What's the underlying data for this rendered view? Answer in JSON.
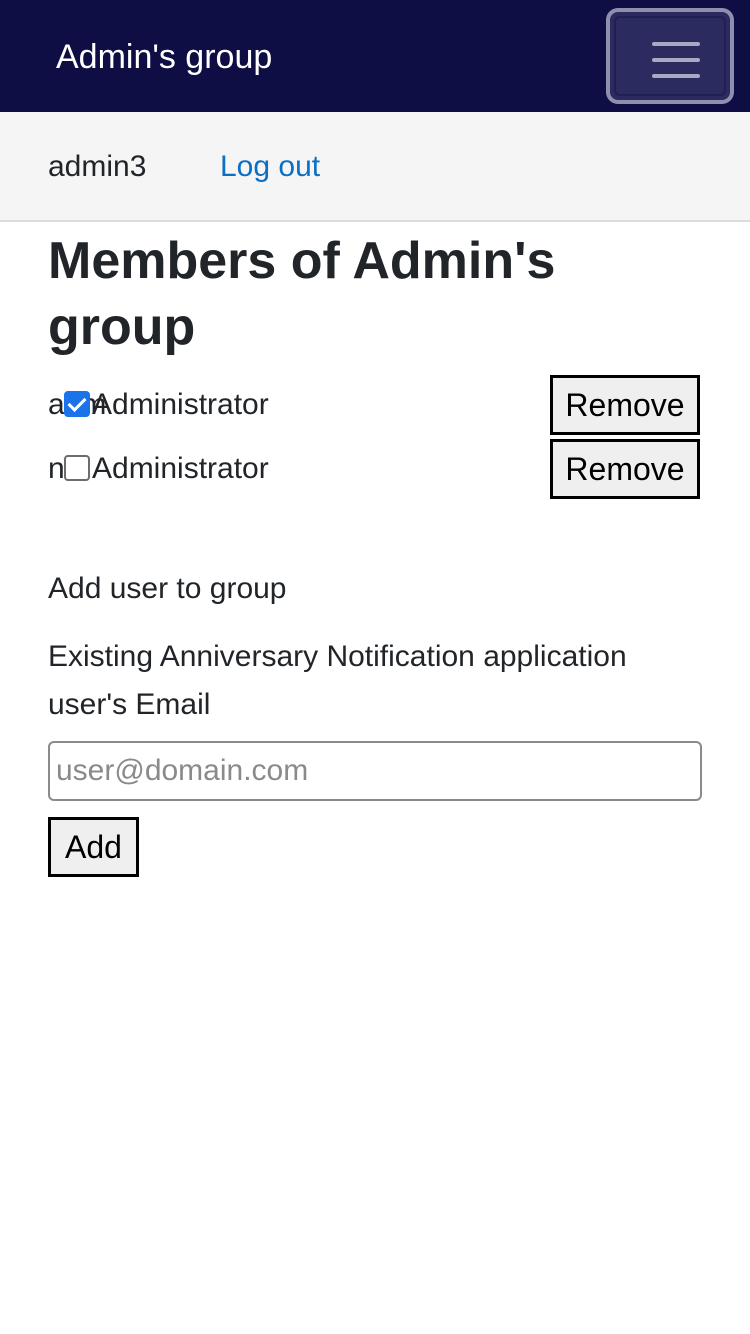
{
  "navbar": {
    "brand": "Admin's group",
    "menu_icon": "hamburger-menu-icon"
  },
  "userbar": {
    "username": "admin3",
    "logout_label": "Log out"
  },
  "page": {
    "title": "Members of Admin's group"
  },
  "members": [
    {
      "name": "admin3",
      "role": "Administrator",
      "checked": true,
      "remove_label": "Remove"
    },
    {
      "name": "n",
      "role": "Administrator",
      "checked": false,
      "remove_label": "Remove"
    }
  ],
  "add_user": {
    "heading": "Add user to group",
    "email_label": "Existing Anniversary Notification application user's Email",
    "email_placeholder": "user@domain.com",
    "email_value": "",
    "add_label": "Add"
  },
  "colors": {
    "navbar_bg": "#0e0e45",
    "link": "#0b6fc3",
    "checkbox_checked": "#1a73e8"
  }
}
